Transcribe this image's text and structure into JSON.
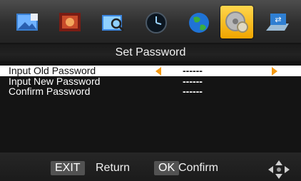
{
  "menu_icons": [
    {
      "name": "picture-icon",
      "selected": false
    },
    {
      "name": "image-icon",
      "selected": false
    },
    {
      "name": "search-icon",
      "selected": false
    },
    {
      "name": "clock-icon",
      "selected": false
    },
    {
      "name": "globe-icon",
      "selected": false
    },
    {
      "name": "settings-disc-icon",
      "selected": true
    },
    {
      "name": "usb-icon",
      "selected": false
    }
  ],
  "dialog": {
    "title": "Set Password",
    "rows": [
      {
        "label": "Input Old Password",
        "value": "------",
        "selected": true
      },
      {
        "label": "Input New Password",
        "value": "------",
        "selected": false
      },
      {
        "label": "Confirm Password",
        "value": "------",
        "selected": false
      }
    ]
  },
  "footer": {
    "exit_key": "EXIT",
    "exit_label": "Return",
    "ok_key": "OK",
    "ok_label": "Confirm"
  },
  "colors": {
    "accent": "#f59a12",
    "selected_row_bg": "#ffffff",
    "background": "#141414"
  }
}
